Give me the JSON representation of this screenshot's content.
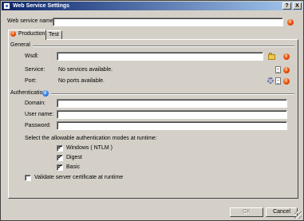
{
  "window": {
    "title": "Web Service Settings"
  },
  "titlebar_buttons": {
    "help": "?",
    "close": "X"
  },
  "name_field": {
    "label": "Web service name:",
    "value": ""
  },
  "tabs": [
    {
      "label": "Production"
    },
    {
      "label": "Test"
    }
  ],
  "general": {
    "heading": "General",
    "wsdl_label": "Wsdl:",
    "wsdl_value": "",
    "service_label": "Service:",
    "service_value": "No services available.",
    "port_label": "Port:",
    "port_value": "No ports available."
  },
  "authentication": {
    "heading": "Authentication",
    "domain_label": "Domain:",
    "username_label": "User name:",
    "password_label": "Password:",
    "modes_text": "Select the allowable authentication modes at runtime:",
    "modes": [
      {
        "label": "Windows ( NTLM )",
        "checked": true
      },
      {
        "label": "Digest",
        "checked": true
      },
      {
        "label": "Basic",
        "checked": true
      }
    ],
    "validate_label": "Validate server certificate at runtime",
    "validate_checked": false
  },
  "buttons": {
    "ok": "OK",
    "cancel": "Cancel"
  },
  "icons": {
    "error": "error-icon",
    "info": "info-icon",
    "check": "✓"
  }
}
